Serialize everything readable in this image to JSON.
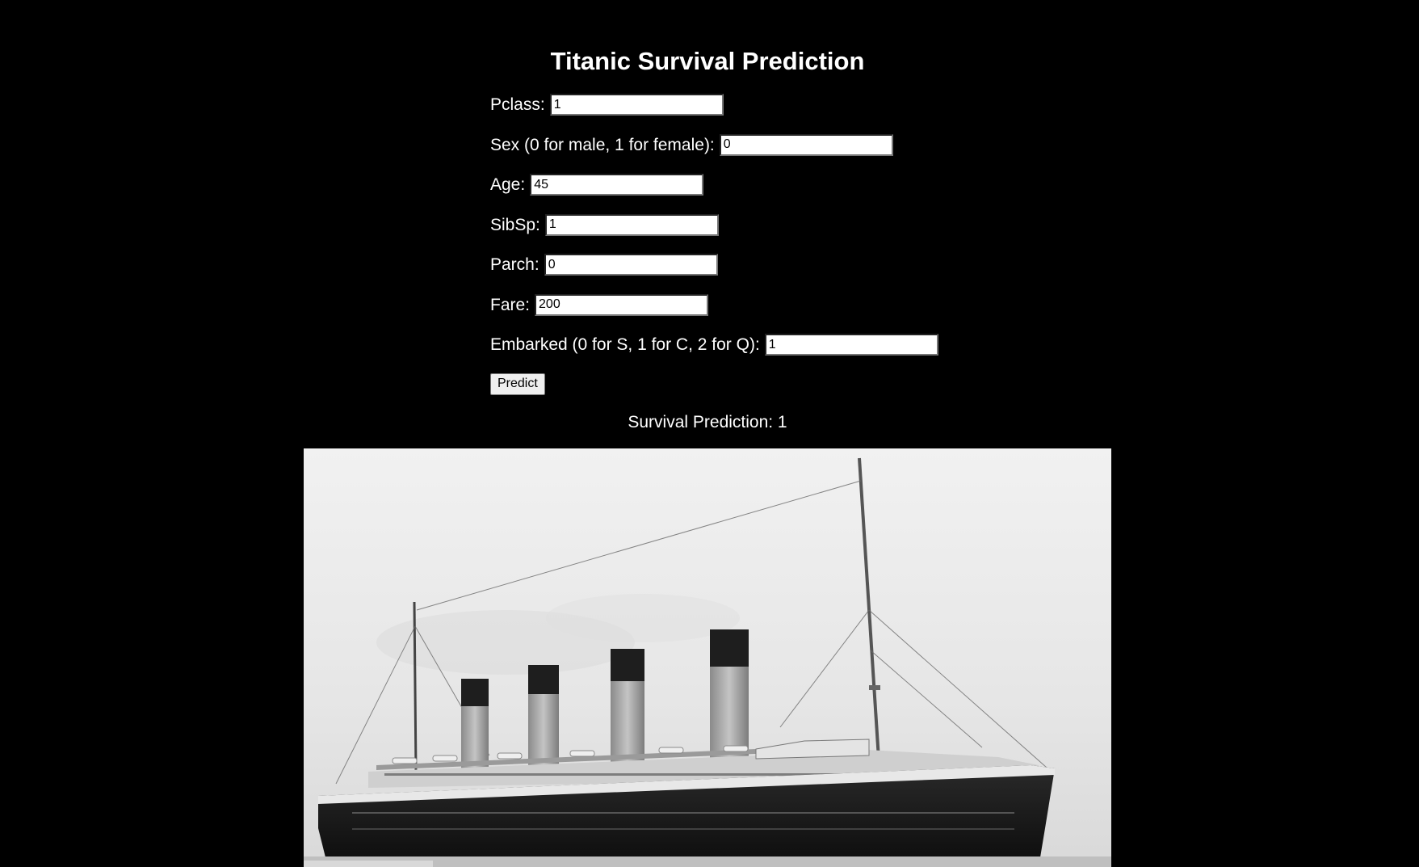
{
  "header": {
    "title": "Titanic Survival Prediction"
  },
  "form": {
    "fields": [
      {
        "key": "pclass",
        "label": "Pclass:",
        "value": "1"
      },
      {
        "key": "sex",
        "label": "Sex (0 for male, 1 for female):",
        "value": "0"
      },
      {
        "key": "age",
        "label": "Age:",
        "value": "45"
      },
      {
        "key": "sibsp",
        "label": "SibSp:",
        "value": "1"
      },
      {
        "key": "parch",
        "label": "Parch:",
        "value": "0"
      },
      {
        "key": "fare",
        "label": "Fare:",
        "value": "200"
      },
      {
        "key": "embarked",
        "label": "Embarked (0 for S, 1 for C, 2 for Q):",
        "value": "1"
      }
    ],
    "submit_label": "Predict"
  },
  "result": {
    "text": "Survival Prediction: 1"
  },
  "image": {
    "subject": "titanic-ship-photo"
  },
  "colors": {
    "background": "#000000",
    "text": "#ffffff"
  }
}
